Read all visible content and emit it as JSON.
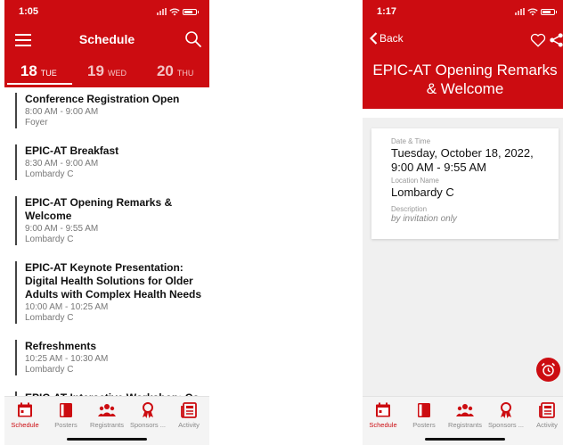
{
  "left_screen": {
    "status_time": "1:05",
    "nav_title": "Schedule",
    "days": [
      {
        "num": "18",
        "dow": "TUE"
      },
      {
        "num": "19",
        "dow": "WED"
      },
      {
        "num": "20",
        "dow": "THU"
      }
    ],
    "sessions": [
      {
        "title": "Conference Registration Open",
        "time": "8:00 AM - 9:00 AM",
        "location": "Foyer"
      },
      {
        "title": "EPIC-AT Breakfast",
        "time": "8:30 AM - 9:00 AM",
        "location": "Lombardy C"
      },
      {
        "title": "EPIC-AT Opening Remarks & Welcome",
        "time": "9:00 AM - 9:55 AM",
        "location": "Lombardy C"
      },
      {
        "title": "EPIC-AT Keynote Presentation: Digital Health Solutions for Older Adults with Complex Health Needs",
        "time": "10:00 AM - 10:25 AM",
        "location": "Lombardy C"
      },
      {
        "title": "Refreshments",
        "time": "10:25 AM - 10:30 AM",
        "location": "Lombardy C"
      },
      {
        "title": "EPIC-AT Interactive Workshop: Co",
        "time": "",
        "location": ""
      }
    ]
  },
  "right_screen": {
    "status_time": "1:17",
    "back_label": "Back",
    "event_title": "EPIC-AT Opening Remarks & Welcome",
    "date_label": "Date & Time",
    "date_value": "Tuesday, October 18, 2022, 9:00 AM - 9:55 AM",
    "location_label": "Location Name",
    "location_value": "Lombardy C",
    "description_label": "Description",
    "description_value": "by invitation only"
  },
  "tabbar": {
    "items": [
      {
        "label": "Schedule",
        "icon": "calendar-icon"
      },
      {
        "label": "Posters",
        "icon": "book-icon"
      },
      {
        "label": "Registrants",
        "icon": "people-icon"
      },
      {
        "label": "Sponsors ...",
        "icon": "award-icon"
      },
      {
        "label": "Activity",
        "icon": "newspaper-icon"
      }
    ]
  },
  "colors": {
    "accent": "#cc0c11"
  }
}
